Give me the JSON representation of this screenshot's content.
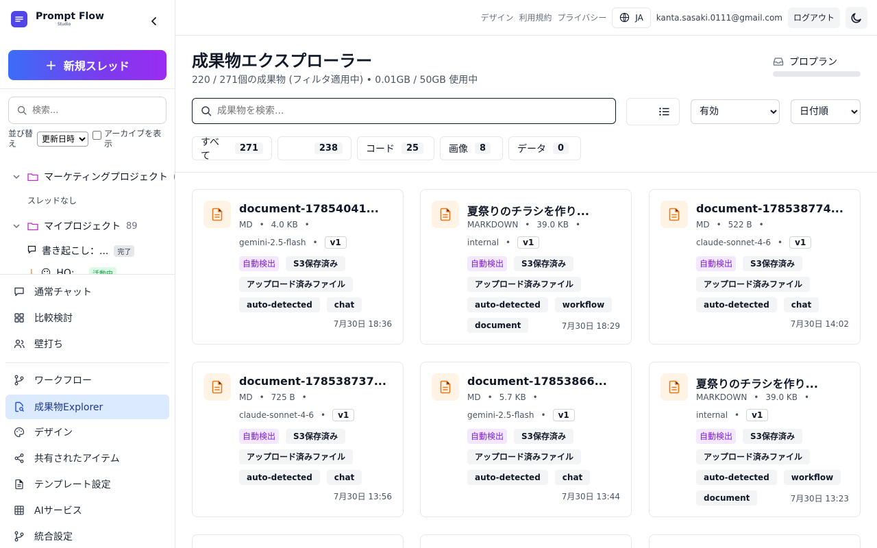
{
  "brand": {
    "name": "Prompt Flow",
    "sub": "Studio"
  },
  "sidebar": {
    "new_thread": "新規スレッド",
    "search_placeholder": "検索...",
    "sort_label": "並び替え",
    "sort_value": "更新日時",
    "archive_label": "アーカイブを表示",
    "tree": [
      {
        "label": "マーケティングプロジェクト",
        "count": "("
      },
      {
        "label": "スレッドなし"
      },
      {
        "label": "マイプロジェクト",
        "count": "89"
      },
      {
        "label": "書き起こし：...",
        "badge": "完了"
      },
      {
        "label": "HQ:...",
        "badge": "活動中"
      }
    ],
    "nav": [
      {
        "label": "通常チャット",
        "icon": "chat-icon"
      },
      {
        "label": "比較検討",
        "icon": "grid-icon"
      },
      {
        "label": "壁打ち",
        "icon": "users-icon"
      },
      {
        "label": "ワークフロー",
        "icon": "branch-icon"
      },
      {
        "label": "成果物Explorer",
        "icon": "file-search-icon",
        "active": true
      },
      {
        "label": "デザイン",
        "icon": "palette-icon"
      },
      {
        "label": "共有されたアイテム",
        "icon": "share-icon"
      },
      {
        "label": "テンプレート設定",
        "icon": "document-icon"
      },
      {
        "label": "AIサービス",
        "icon": "table-icon"
      },
      {
        "label": "統合設定",
        "icon": "branch-icon"
      }
    ]
  },
  "topbar": {
    "links": [
      "デザイン",
      "利用規約",
      "プライバシー"
    ],
    "lang": "JA",
    "email": "kanta.sasaki.0111@gmail.com",
    "logout": "ログアウト"
  },
  "main": {
    "title": "成果物エクスプローラー",
    "subtitle": "220 / 271個の成果物 (フィルタ適用中) • 0.01GB / 50GB 使用中",
    "plan": "プロプラン",
    "search_placeholder": "成果物を検索...",
    "status_select": "有効",
    "sort_select": "日付順",
    "filters": [
      {
        "label": "すべて",
        "count": "271"
      },
      {
        "label": "",
        "count": "238"
      },
      {
        "label": "コード",
        "count": "25"
      },
      {
        "label": "画像",
        "count": "8"
      },
      {
        "label": "データ",
        "count": "0"
      }
    ]
  },
  "cards": [
    {
      "title": "document-17854041...",
      "type": "MD",
      "size": "4.0 KB",
      "model": "gemini-2.5-flash",
      "version": "v1",
      "tags": [
        "自動検出",
        "S3保存済み",
        "アップロード済みファイル",
        "auto-detected",
        "chat"
      ],
      "date": "7月30日 18:36"
    },
    {
      "title": "夏祭りのチラシを作り...",
      "type": "MARKDOWN",
      "size": "39.0 KB",
      "model": "internal",
      "version": "v1",
      "tags": [
        "自動検出",
        "S3保存済み",
        "アップロード済みファイル",
        "auto-detected",
        "workflow",
        "document"
      ],
      "date": "7月30日 18:29"
    },
    {
      "title": "document-178538774...",
      "type": "MD",
      "size": "522 B",
      "model": "claude-sonnet-4-6",
      "version": "v1",
      "tags": [
        "自動検出",
        "S3保存済み",
        "アップロード済みファイル",
        "auto-detected",
        "chat"
      ],
      "date": "7月30日 14:02"
    },
    {
      "title": "document-178538737...",
      "type": "MD",
      "size": "725 B",
      "model": "claude-sonnet-4-6",
      "version": "v1",
      "tags": [
        "自動検出",
        "S3保存済み",
        "アップロード済みファイル",
        "auto-detected",
        "chat"
      ],
      "date": "7月30日 13:56"
    },
    {
      "title": "document-17853866...",
      "type": "MD",
      "size": "5.7 KB",
      "model": "gemini-2.5-flash",
      "version": "v1",
      "tags": [
        "自動検出",
        "S3保存済み",
        "アップロード済みファイル",
        "auto-detected",
        "chat"
      ],
      "date": "7月30日 13:44"
    },
    {
      "title": "夏祭りのチラシを作り...",
      "type": "MARKDOWN",
      "size": "39.0 KB",
      "model": "internal",
      "version": "v1",
      "tags": [
        "自動検出",
        "S3保存済み",
        "アップロード済みファイル",
        "auto-detected",
        "workflow",
        "document"
      ],
      "date": "7月30日 13:23"
    }
  ],
  "colors": {
    "accent": "#4f46e5",
    "file_icon": "#ea7a1a",
    "active_nav": "#dbeafe",
    "tag_purple": "#7e22ce"
  }
}
